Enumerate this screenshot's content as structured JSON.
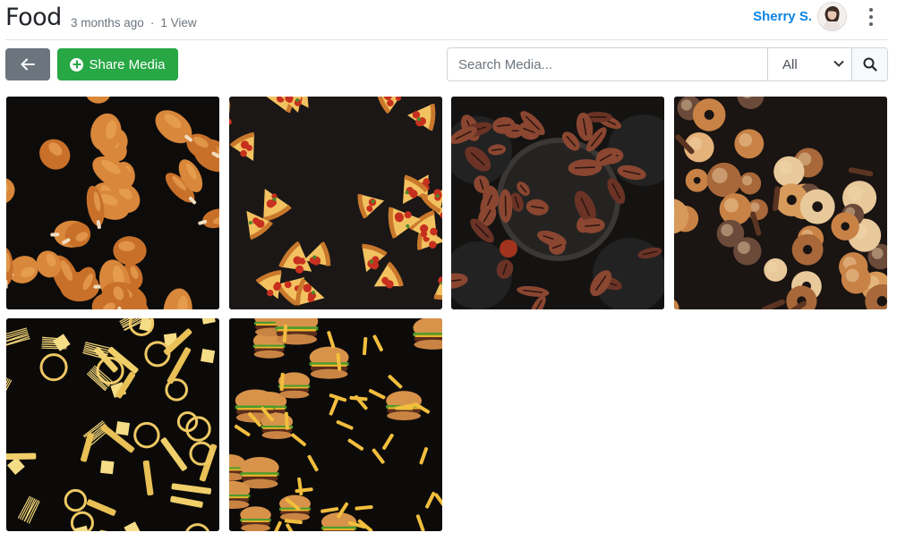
{
  "header": {
    "title": "Food",
    "time_ago": "3 months ago",
    "views": "1 View",
    "user_name": "Sherry S."
  },
  "toolbar": {
    "back_icon": "arrow-left-icon",
    "share_label": "Share Media",
    "share_icon": "plus-circle-icon"
  },
  "search": {
    "placeholder": "Search Media...",
    "value": "",
    "filter_selected": "All",
    "search_icon": "magnifier-icon"
  },
  "colors": {
    "brand_blue": "#0d84e3",
    "back_gray": "#6c757d",
    "share_green": "#28a745"
  },
  "media": [
    {
      "name": "fried-chicken-thumbnail",
      "subject": "fried chicken"
    },
    {
      "name": "pizza-slices-thumbnail",
      "subject": "pizza slices"
    },
    {
      "name": "grilled-meat-thumbnail",
      "subject": "grilled meat"
    },
    {
      "name": "pastries-thumbnail",
      "subject": "pastries"
    },
    {
      "name": "pasta-thumbnail",
      "subject": "dry pasta"
    },
    {
      "name": "burgers-fries-thumbnail",
      "subject": "burgers and fries"
    }
  ]
}
